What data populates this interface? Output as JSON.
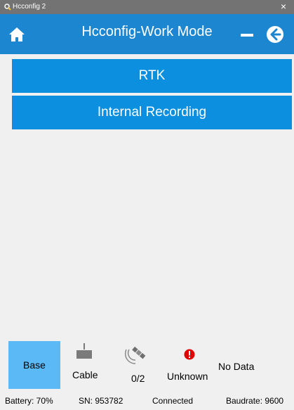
{
  "window": {
    "title": "Hcconfig 2",
    "close_glyph": "×"
  },
  "header": {
    "title": "Hcconfig-Work Mode",
    "home_icon": "home-icon",
    "minimize_icon": "minus-icon",
    "back_icon": "back-arrow-icon"
  },
  "menu": {
    "items": [
      {
        "label": "RTK"
      },
      {
        "label": "Internal Recording"
      }
    ]
  },
  "status": {
    "mode": "Base",
    "connection_type": "Cable",
    "satellites": "0/2",
    "solution": "Unknown",
    "data": "No Data"
  },
  "footer": {
    "battery": "Battery: 70%",
    "serial": "SN: 953782",
    "connection": "Connected",
    "baudrate": "Baudrate: 9600"
  },
  "colors": {
    "titlebar": "#737373",
    "appbar": "#1c86d1",
    "button": "#0d8fe0",
    "base_button": "#5bb9f6",
    "error": "#e00000",
    "icon_gray": "#7a7a7a"
  }
}
